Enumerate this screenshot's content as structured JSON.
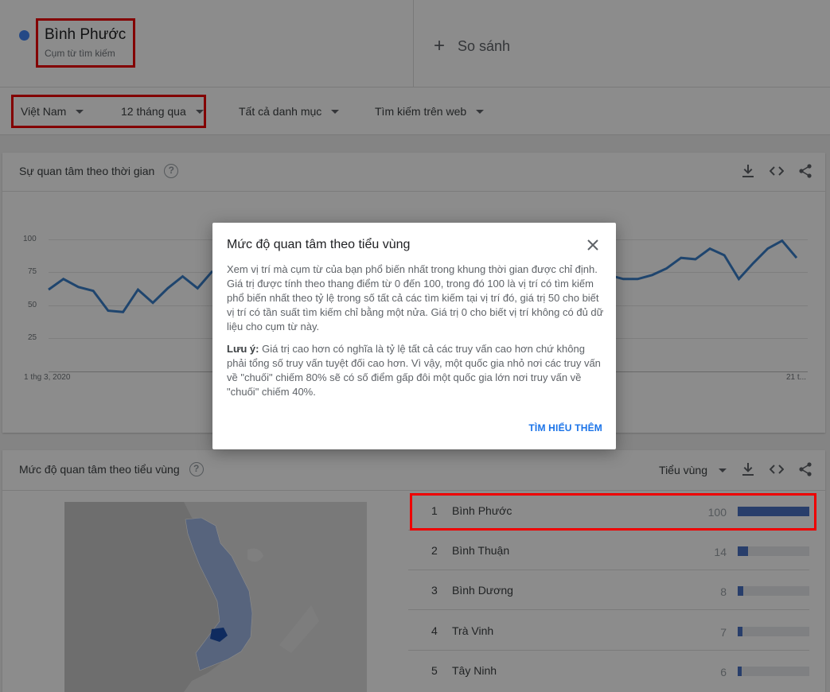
{
  "header": {
    "term_name": "Bình Phước",
    "term_sub": "Cụm từ tìm kiếm",
    "term_color": "#4285f4",
    "compare_label": "So sánh"
  },
  "filters": {
    "geo": "Việt Nam",
    "time": "12 tháng qua",
    "category": "Tất cả danh mục",
    "search_type": "Tìm kiếm trên web"
  },
  "interest_time": {
    "title": "Sự quan tâm theo thời gian",
    "y_ticks": [
      "100",
      "75",
      "50",
      "25"
    ],
    "x_start": "1 thg 3, 2020",
    "x_end": "21 t..."
  },
  "chart_data": {
    "type": "line",
    "title": "Sự quan tâm theo thời gian",
    "xlabel": "",
    "ylabel": "",
    "ylim": [
      0,
      100
    ],
    "x_tick_labels": [
      "1 thg 3, 2020",
      "21 t..."
    ],
    "series": [
      {
        "color": "#3a7ec8",
        "values_visible_left": [
          62,
          70,
          64,
          61,
          46,
          45,
          62,
          52,
          63,
          72,
          63,
          76
        ],
        "values_visible_right": [
          73,
          70,
          70,
          73,
          78,
          86,
          85,
          93,
          88,
          70,
          82,
          93,
          99,
          86
        ]
      }
    ]
  },
  "interest_region": {
    "title": "Mức độ quan tâm theo tiểu vùng",
    "scope_label": "Tiểu vùng",
    "rows": [
      {
        "rank": "1",
        "name": "Bình Phước",
        "value": "100",
        "pct": 100
      },
      {
        "rank": "2",
        "name": "Bình Thuận",
        "value": "14",
        "pct": 14
      },
      {
        "rank": "3",
        "name": "Bình Dương",
        "value": "8",
        "pct": 8
      },
      {
        "rank": "4",
        "name": "Trà Vinh",
        "value": "7",
        "pct": 7
      },
      {
        "rank": "5",
        "name": "Tây Ninh",
        "value": "6",
        "pct": 6
      }
    ]
  },
  "dialog": {
    "title": "Mức độ quan tâm theo tiểu vùng",
    "body": "Xem vị trí mà cụm từ của bạn phổ biến nhất trong khung thời gian được chỉ định. Giá trị được tính theo thang điểm từ 0 đến 100, trong đó 100 là vị trí có tìm kiếm phổ biến nhất theo tỷ lệ trong số tất cả các tìm kiếm tại vị trí đó, giá trị 50 cho biết vị trí có tần suất tìm kiếm chỉ bằng một nửa. Giá trị 0 cho biết vị trí không có đủ dữ liệu cho cụm từ này.",
    "note_label": "Lưu ý:",
    "note_text": " Giá trị cao hơn có nghĩa là tỷ lệ tất cả các truy vấn cao hơn chứ không phải tổng số truy vấn tuyệt đối cao hơn. Vì vậy, một quốc gia nhỏ nơi các truy vấn về \"chuối\" chiếm 80% sẽ có số điểm gấp đôi một quốc gia lớn nơi truy vấn về \"chuối\" chiếm 40%.",
    "link": "TÌM HIỂU THÊM"
  },
  "icons": [
    "download-icon",
    "embed-icon",
    "share-icon",
    "help-icon",
    "close-icon",
    "plus-icon",
    "caret-down-icon"
  ]
}
